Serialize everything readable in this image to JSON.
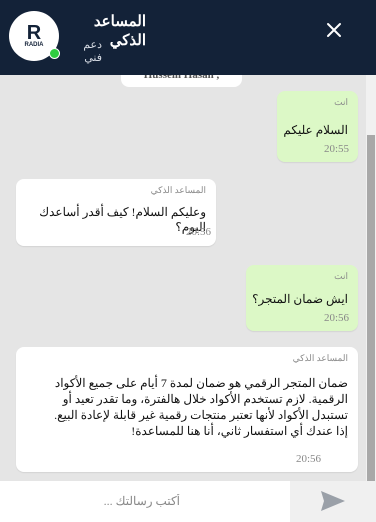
{
  "header": {
    "title": "المساعد الذكي",
    "subtitle": "دعم فني",
    "avatar_logo": "R",
    "avatar_logo_sub": "RADIA",
    "online": true,
    "close_icon": "close-icon"
  },
  "chat": {
    "peek_text": "Hussein Hasan ,",
    "messages": [
      {
        "role": "user",
        "sender": "انت",
        "lines": [
          "السلام عليكم"
        ],
        "time": "20:55"
      },
      {
        "role": "bot",
        "sender": "المساعد الذكي",
        "lines": [
          "وعليكم السلام! كيف أقدر أساعدك اليوم؟"
        ],
        "time": "20:56"
      },
      {
        "role": "user",
        "sender": "انت",
        "lines": [
          "ايش ضمان المتجر؟"
        ],
        "time": "20:56"
      },
      {
        "role": "bot",
        "sender": "المساعد الذكي",
        "lines": [
          "ضمان المتجر الرقمي هو ضمان لمدة 7 أيام على جميع الأكواد",
          "الرقمية. لازم تستخدم الأكواد خلال هالفترة، وما تقدر تعيد أو",
          "تستبدل الأكواد لأنها تعتبر منتجات رقمية غير قابلة لإعادة البيع.",
          "إذا عندك أي استفسار ثاني، أنا هنا للمساعدة!"
        ],
        "time": "20:56"
      }
    ]
  },
  "composer": {
    "placeholder": "أكتب رسالتك ...",
    "value": "",
    "send_icon": "send-icon"
  },
  "colors": {
    "header_bg": "#132238",
    "chat_bg": "#e5e5e5",
    "user_bubble": "#dcf8c6",
    "bot_bubble": "#ffffff",
    "online": "#2ecc40"
  }
}
